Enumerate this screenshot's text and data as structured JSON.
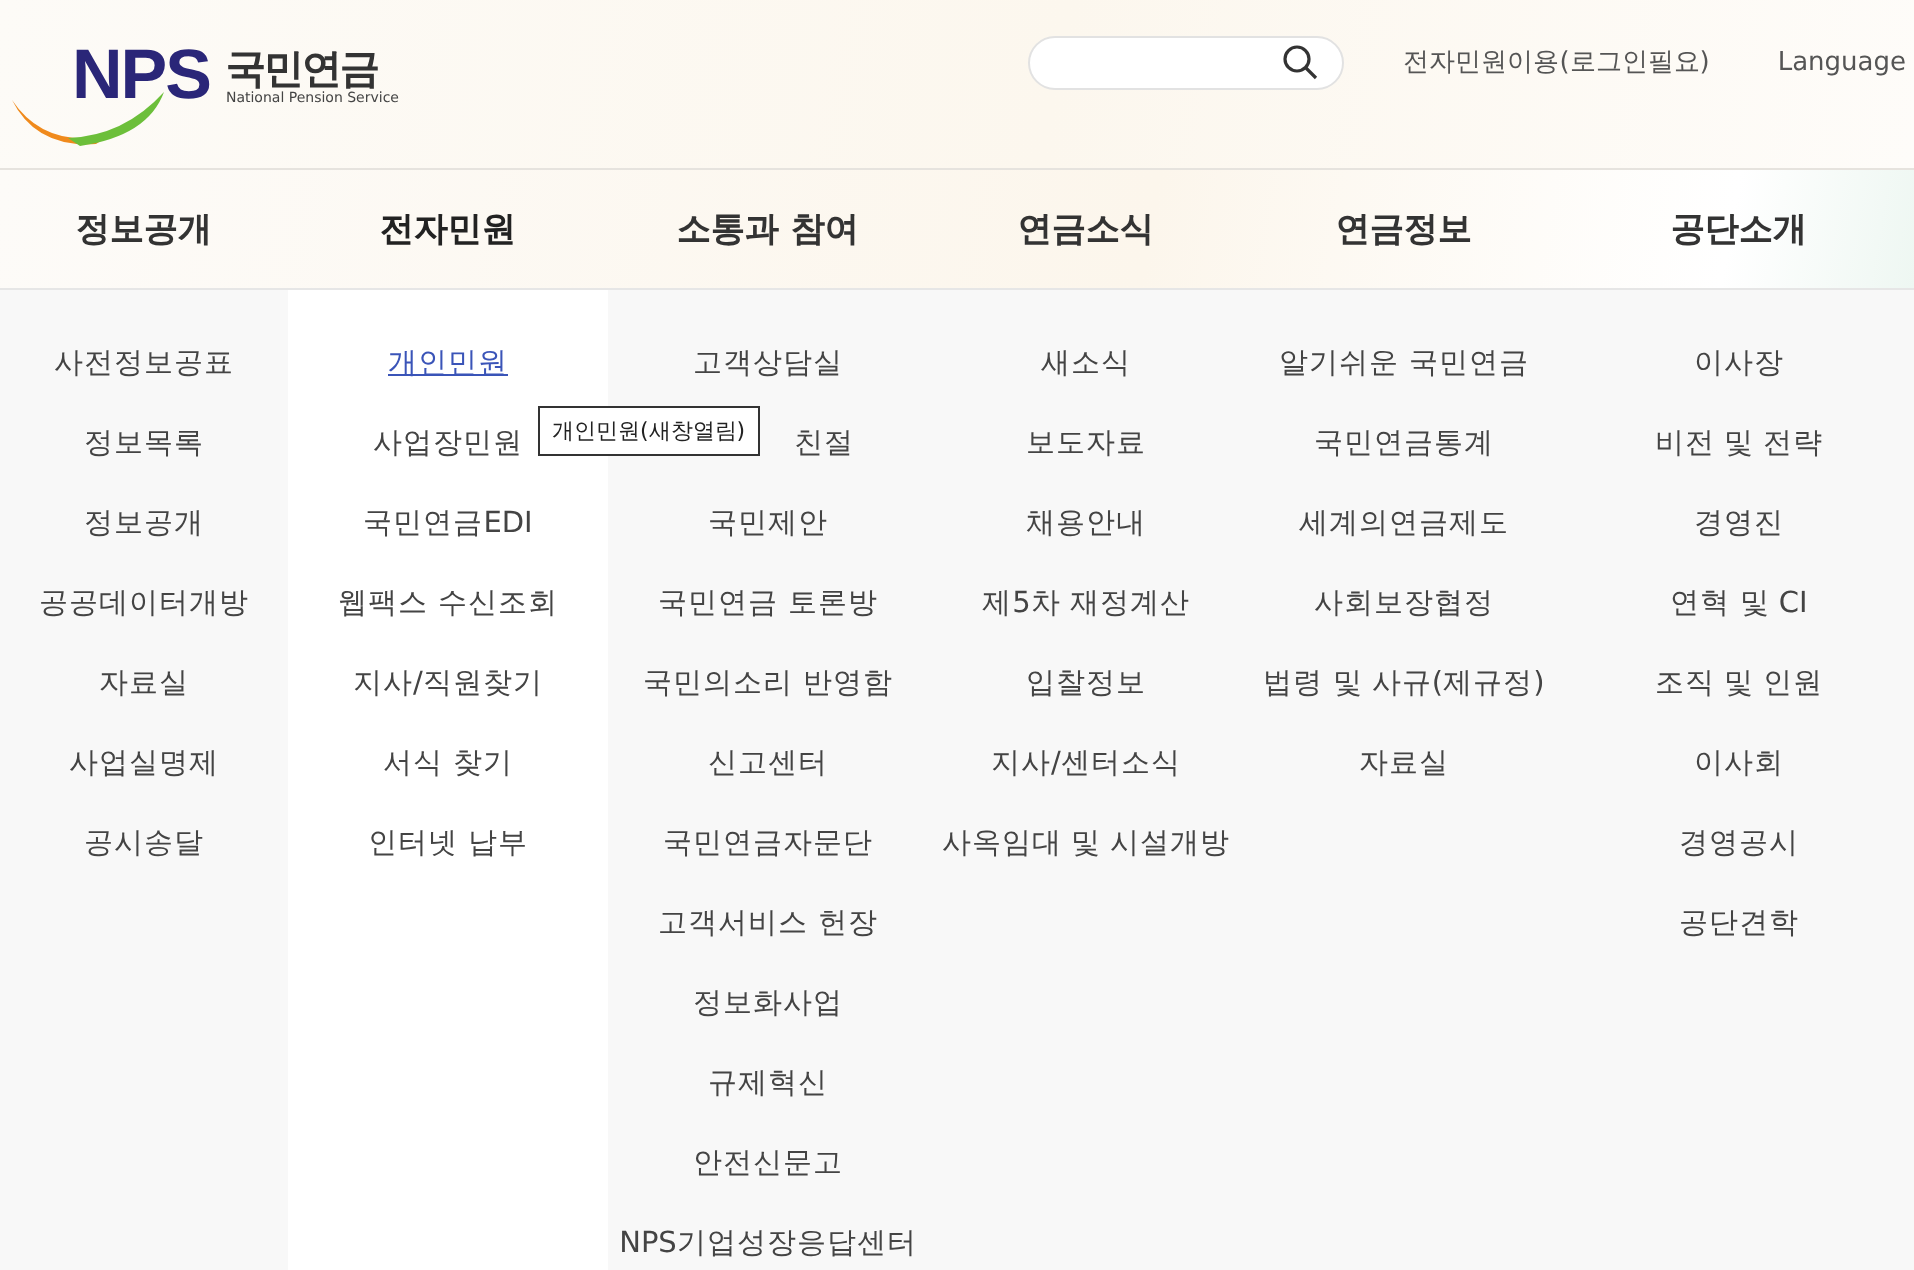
{
  "logo": {
    "mark": "NPS",
    "title": "국민연금",
    "subtitle": "National Pension Service"
  },
  "utility_links": [
    "전자민원이용(로그인필요)",
    "Language"
  ],
  "menu": [
    {
      "label": "정보공개",
      "selected": false,
      "items": [
        {
          "label": "사전정보공표",
          "selected": false
        },
        {
          "label": "정보목록",
          "selected": false
        },
        {
          "label": "정보공개",
          "selected": false
        },
        {
          "label": "공공데이터개방",
          "selected": false
        },
        {
          "label": "자료실",
          "selected": false
        },
        {
          "label": "사업실명제",
          "selected": false
        },
        {
          "label": "공시송달",
          "selected": false
        }
      ]
    },
    {
      "label": "전자민원",
      "selected": true,
      "items": [
        {
          "label": "개인민원",
          "selected": true
        },
        {
          "label": "사업장민원",
          "selected": false
        },
        {
          "label": "국민연금EDI",
          "selected": false
        },
        {
          "label": "웹팩스 수신조회",
          "selected": false
        },
        {
          "label": "지사/직원찾기",
          "selected": false
        },
        {
          "label": "서식 찾기",
          "selected": false
        },
        {
          "label": "인터넷 납부",
          "selected": false
        }
      ]
    },
    {
      "label": "소통과 참여",
      "selected": false,
      "items": [
        {
          "label": "고객상담실",
          "selected": false
        },
        {
          "label": "친절",
          "selected": false,
          "kind": "covered"
        },
        {
          "label": "국민제안",
          "selected": false
        },
        {
          "label": "국민연금 토론방",
          "selected": false
        },
        {
          "label": "국민의소리 반영함",
          "selected": false
        },
        {
          "label": "신고센터",
          "selected": false
        },
        {
          "label": "국민연금자문단",
          "selected": false
        },
        {
          "label": "고객서비스 헌장",
          "selected": false
        },
        {
          "label": "정보화사업",
          "selected": false
        },
        {
          "label": "규제혁신",
          "selected": false
        },
        {
          "label": "안전신문고",
          "selected": false
        },
        {
          "label": "NPS기업성장응답센터",
          "selected": false
        }
      ]
    },
    {
      "label": "연금소식",
      "selected": false,
      "items": [
        {
          "label": "새소식",
          "selected": false
        },
        {
          "label": "보도자료",
          "selected": false
        },
        {
          "label": "채용안내",
          "selected": false
        },
        {
          "label": "제5차 재정계산",
          "selected": false
        },
        {
          "label": "입찰정보",
          "selected": false
        },
        {
          "label": "지사/센터소식",
          "selected": false
        },
        {
          "label": "사옥임대 및 시설개방",
          "selected": false
        }
      ]
    },
    {
      "label": "연금정보",
      "selected": false,
      "items": [
        {
          "label": "알기쉬운 국민연금",
          "selected": false
        },
        {
          "label": "국민연금통계",
          "selected": false
        },
        {
          "label": "세계의연금제도",
          "selected": false
        },
        {
          "label": "사회보장협정",
          "selected": false
        },
        {
          "label": "법령 및 사규(제규정)",
          "selected": false
        },
        {
          "label": "자료실",
          "selected": false
        }
      ]
    },
    {
      "label": "공단소개",
      "selected": false,
      "items": [
        {
          "label": "이사장",
          "selected": false
        },
        {
          "label": "비전 및 전략",
          "selected": false
        },
        {
          "label": "경영진",
          "selected": false
        },
        {
          "label": "연혁 및 CI",
          "selected": false
        },
        {
          "label": "조직 및 인원",
          "selected": false
        },
        {
          "label": "이사회",
          "selected": false
        },
        {
          "label": "경영공시",
          "selected": false
        },
        {
          "label": "공단견학",
          "selected": false
        }
      ]
    }
  ],
  "tooltip": {
    "text": "개인민원(새창열림)"
  }
}
